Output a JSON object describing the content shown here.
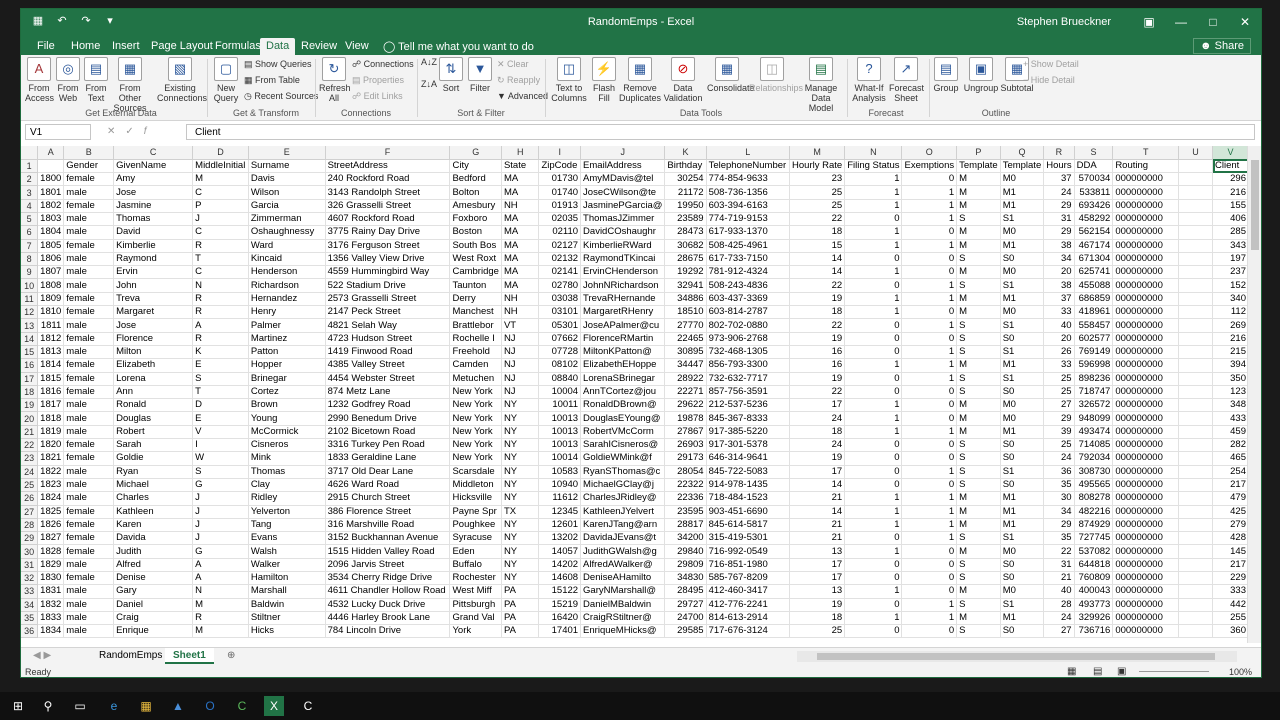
{
  "window": {
    "title": "RandomEmps - Excel",
    "user": "Stephen Brueckner"
  },
  "tabs": [
    "File",
    "Home",
    "Insert",
    "Page Layout",
    "Formulas",
    "Data",
    "Review",
    "View"
  ],
  "tell_me": "Tell me what you want to do",
  "share": "Share",
  "ribbon": {
    "from_access": "From Access",
    "from_web": "From Web",
    "from_text": "From Text",
    "from_other": "From Other Sources",
    "existing_connections": "Existing Connections",
    "new_query": "New Query",
    "show_queries": "Show Queries",
    "from_table": "From Table",
    "recent_sources": "Recent Sources",
    "refresh_all": "Refresh All",
    "connections": "Connections",
    "properties": "Properties",
    "edit_links": "Edit Links",
    "sort": "Sort",
    "filter": "Filter",
    "clear": "Clear",
    "reapply": "Reapply",
    "advanced": "Advanced",
    "text_to_columns": "Text to Columns",
    "flash_fill": "Flash Fill",
    "remove_duplicates": "Remove Duplicates",
    "data_validation": "Data Validation",
    "consolidate": "Consolidate",
    "relationships": "Relationships",
    "manage_data_model": "Manage Data Model",
    "what_if": "What-If Analysis",
    "forecast_sheet": "Forecast Sheet",
    "group": "Group",
    "ungroup": "Ungroup",
    "subtotal": "Subtotal",
    "show_detail": "Show Detail",
    "hide_detail": "Hide Detail",
    "groups": [
      "Get External Data",
      "Get & Transform",
      "Connections",
      "Sort & Filter",
      "Data Tools",
      "Forecast",
      "Outline"
    ]
  },
  "name_box": "V1",
  "formula": "Client",
  "columns": [
    "A",
    "B",
    "C",
    "D",
    "E",
    "F",
    "G",
    "H",
    "I",
    "J",
    "K",
    "L",
    "M",
    "N",
    "O",
    "P",
    "Q",
    "R",
    "S",
    "T",
    "U",
    "V"
  ],
  "header_row": [
    "",
    "Gender",
    "GivenName",
    "MiddleInitial",
    "Surname",
    "StreetAddress",
    "City",
    "State",
    "ZipCode",
    "EmailAddress",
    "Birthday",
    "TelephoneNumber",
    "Hourly Rate",
    "Filing Status",
    "Exemptions",
    "Template",
    "Template",
    "Hours",
    "DDA",
    "Routing",
    "",
    "Client"
  ],
  "rows": [
    [
      "1800",
      "female",
      "Amy",
      "M",
      "Davis",
      "240 Rockford Road",
      "Bedford",
      "MA",
      "01730",
      "AmyMDavis@tel",
      "30254",
      "774-854-9633",
      "23",
      "1",
      "0",
      "M",
      "M0",
      "37",
      "570034",
      "000000000",
      "",
      "296"
    ],
    [
      "1801",
      "male",
      "Jose",
      "C",
      "Wilson",
      "3143 Randolph Street",
      "Bolton",
      "MA",
      "01740",
      "JoseCWilson@te",
      "21172",
      "508-736-1356",
      "25",
      "1",
      "1",
      "M",
      "M1",
      "24",
      "533811",
      "000000000",
      "",
      "216"
    ],
    [
      "1802",
      "female",
      "Jasmine",
      "P",
      "Garcia",
      "326 Grasselli Street",
      "Amesbury",
      "NH",
      "01913",
      "JasminePGarcia@",
      "19950",
      "603-394-6163",
      "25",
      "1",
      "1",
      "M",
      "M1",
      "29",
      "693426",
      "000000000",
      "",
      "155"
    ],
    [
      "1803",
      "male",
      "Thomas",
      "J",
      "Zimmerman",
      "4607 Rockford Road",
      "Foxboro",
      "MA",
      "02035",
      "ThomasJZimmer",
      "23589",
      "774-719-9153",
      "22",
      "0",
      "1",
      "S",
      "S1",
      "31",
      "458292",
      "000000000",
      "",
      "406"
    ],
    [
      "1804",
      "male",
      "David",
      "C",
      "Oshaughnessy",
      "3775 Rainy Day Drive",
      "Boston",
      "MA",
      "02110",
      "DavidCOshaughr",
      "28473",
      "617-933-1370",
      "18",
      "1",
      "0",
      "M",
      "M0",
      "29",
      "562154",
      "000000000",
      "",
      "285"
    ],
    [
      "1805",
      "female",
      "Kimberlie",
      "R",
      "Ward",
      "3176 Ferguson Street",
      "South Bos",
      "MA",
      "02127",
      "KimberlieRWard",
      "30682",
      "508-425-4961",
      "15",
      "1",
      "1",
      "M",
      "M1",
      "38",
      "467174",
      "000000000",
      "",
      "343"
    ],
    [
      "1806",
      "male",
      "Raymond",
      "T",
      "Kincaid",
      "1356 Valley View Drive",
      "West Roxt",
      "MA",
      "02132",
      "RaymondTKincai",
      "28675",
      "617-733-7150",
      "14",
      "0",
      "0",
      "S",
      "S0",
      "34",
      "671304",
      "000000000",
      "",
      "197"
    ],
    [
      "1807",
      "male",
      "Ervin",
      "C",
      "Henderson",
      "4559 Hummingbird Way",
      "Cambridge",
      "MA",
      "02141",
      "ErvinCHenderson",
      "19292",
      "781-912-4324",
      "14",
      "1",
      "0",
      "M",
      "M0",
      "20",
      "625741",
      "000000000",
      "",
      "237"
    ],
    [
      "1808",
      "male",
      "John",
      "N",
      "Richardson",
      "522 Stadium Drive",
      "Taunton",
      "MA",
      "02780",
      "JohnNRichardson",
      "32941",
      "508-243-4836",
      "22",
      "0",
      "1",
      "S",
      "S1",
      "38",
      "455088",
      "000000000",
      "",
      "152"
    ],
    [
      "1809",
      "female",
      "Treva",
      "R",
      "Hernandez",
      "2573 Grasselli Street",
      "Derry",
      "NH",
      "03038",
      "TrevaRHernande",
      "34886",
      "603-437-3369",
      "19",
      "1",
      "1",
      "M",
      "M1",
      "37",
      "686859",
      "000000000",
      "",
      "340"
    ],
    [
      "1810",
      "female",
      "Margaret",
      "R",
      "Henry",
      "2147 Peck Street",
      "Manchest",
      "NH",
      "03101",
      "MargaretRHenry",
      "18510",
      "603-814-2787",
      "18",
      "1",
      "0",
      "M",
      "M0",
      "33",
      "418961",
      "000000000",
      "",
      "112"
    ],
    [
      "1811",
      "male",
      "Jose",
      "A",
      "Palmer",
      "4821 Selah Way",
      "Brattlebor",
      "VT",
      "05301",
      "JoseAPalmer@cu",
      "27770",
      "802-702-0880",
      "22",
      "0",
      "1",
      "S",
      "S1",
      "40",
      "558457",
      "000000000",
      "",
      "269"
    ],
    [
      "1812",
      "female",
      "Florence",
      "R",
      "Martinez",
      "4723 Hudson Street",
      "Rochelle I",
      "NJ",
      "07662",
      "FlorenceRMartin",
      "22465",
      "973-906-2768",
      "19",
      "0",
      "0",
      "S",
      "S0",
      "20",
      "602577",
      "000000000",
      "",
      "216"
    ],
    [
      "1813",
      "male",
      "Milton",
      "K",
      "Patton",
      "1419 Finwood Road",
      "Freehold",
      "NJ",
      "07728",
      "MiltonKPatton@",
      "30895",
      "732-468-1305",
      "16",
      "0",
      "1",
      "S",
      "S1",
      "26",
      "769149",
      "000000000",
      "",
      "215"
    ],
    [
      "1814",
      "female",
      "Elizabeth",
      "E",
      "Hopper",
      "4385 Valley Street",
      "Camden",
      "NJ",
      "08102",
      "ElizabethEHoppe",
      "34447",
      "856-793-3300",
      "16",
      "1",
      "1",
      "M",
      "M1",
      "33",
      "596998",
      "000000000",
      "",
      "394"
    ],
    [
      "1815",
      "female",
      "Lorena",
      "S",
      "Brinegar",
      "4454 Webster Street",
      "Metuchen",
      "NJ",
      "08840",
      "LorenaSBrinegar",
      "28922",
      "732-632-7717",
      "19",
      "0",
      "1",
      "S",
      "S1",
      "25",
      "898236",
      "000000000",
      "",
      "350"
    ],
    [
      "1816",
      "female",
      "Ann",
      "T",
      "Cortez",
      "874 Metz Lane",
      "New York",
      "NJ",
      "10004",
      "AnnTCortez@jou",
      "22271",
      "857-756-3591",
      "22",
      "0",
      "0",
      "S",
      "S0",
      "25",
      "718747",
      "000000000",
      "",
      "123"
    ],
    [
      "1817",
      "male",
      "Ronald",
      "D",
      "Brown",
      "1232 Godfrey Road",
      "New York",
      "NY",
      "10011",
      "RonaldDBrown@",
      "29622",
      "212-537-5236",
      "17",
      "1",
      "0",
      "M",
      "M0",
      "27",
      "326572",
      "000000000",
      "",
      "348"
    ],
    [
      "1818",
      "male",
      "Douglas",
      "E",
      "Young",
      "2990 Benedum Drive",
      "New York",
      "NY",
      "10013",
      "DouglasEYoung@",
      "19878",
      "845-367-8333",
      "24",
      "1",
      "0",
      "M",
      "M0",
      "29",
      "948099",
      "000000000",
      "",
      "433"
    ],
    [
      "1819",
      "male",
      "Robert",
      "V",
      "McCormick",
      "2102 Bicetown Road",
      "New York",
      "NY",
      "10013",
      "RobertVMcCorm",
      "27867",
      "917-385-5220",
      "18",
      "1",
      "1",
      "M",
      "M1",
      "39",
      "493474",
      "000000000",
      "",
      "459"
    ],
    [
      "1820",
      "female",
      "Sarah",
      "I",
      "Cisneros",
      "3316 Turkey Pen Road",
      "New York",
      "NY",
      "10013",
      "SarahICisneros@",
      "26903",
      "917-301-5378",
      "24",
      "0",
      "0",
      "S",
      "S0",
      "25",
      "714085",
      "000000000",
      "",
      "282"
    ],
    [
      "1821",
      "female",
      "Goldie",
      "W",
      "Mink",
      "1833 Geraldine Lane",
      "New York",
      "NY",
      "10014",
      "GoldieWMink@f",
      "29173",
      "646-314-9641",
      "19",
      "0",
      "0",
      "S",
      "S0",
      "24",
      "792034",
      "000000000",
      "",
      "465"
    ],
    [
      "1822",
      "male",
      "Ryan",
      "S",
      "Thomas",
      "3717 Old Dear Lane",
      "Scarsdale",
      "NY",
      "10583",
      "RyanSThomas@c",
      "28054",
      "845-722-5083",
      "17",
      "0",
      "1",
      "S",
      "S1",
      "36",
      "308730",
      "000000000",
      "",
      "254"
    ],
    [
      "1823",
      "male",
      "Michael",
      "G",
      "Clay",
      "4626 Ward Road",
      "Middleton",
      "NY",
      "10940",
      "MichaelGClay@j",
      "22322",
      "914-978-1435",
      "14",
      "0",
      "0",
      "S",
      "S0",
      "35",
      "495565",
      "000000000",
      "",
      "217"
    ],
    [
      "1824",
      "male",
      "Charles",
      "J",
      "Ridley",
      "2915 Church Street",
      "Hicksville",
      "NY",
      "11612",
      "CharlesJRidley@",
      "22336",
      "718-484-1523",
      "21",
      "1",
      "1",
      "M",
      "M1",
      "30",
      "808278",
      "000000000",
      "",
      "479"
    ],
    [
      "1825",
      "female",
      "Kathleen",
      "J",
      "Yelverton",
      "386 Florence Street",
      "Payne Spr",
      "TX",
      "12345",
      "KathleenJYelvert",
      "23595",
      "903-451-6690",
      "14",
      "1",
      "1",
      "M",
      "M1",
      "34",
      "482216",
      "000000000",
      "",
      "425"
    ],
    [
      "1826",
      "female",
      "Karen",
      "J",
      "Tang",
      "316 Marshville Road",
      "Poughkee",
      "NY",
      "12601",
      "KarenJTang@arn",
      "28817",
      "845-614-5817",
      "21",
      "1",
      "1",
      "M",
      "M1",
      "29",
      "874929",
      "000000000",
      "",
      "279"
    ],
    [
      "1827",
      "female",
      "Davida",
      "J",
      "Evans",
      "3152 Buckhannan Avenue",
      "Syracuse",
      "NY",
      "13202",
      "DavidaJEvans@t",
      "34200",
      "315-419-5301",
      "21",
      "0",
      "1",
      "S",
      "S1",
      "35",
      "727745",
      "000000000",
      "",
      "428"
    ],
    [
      "1828",
      "female",
      "Judith",
      "G",
      "Walsh",
      "1515 Hidden Valley Road",
      "Eden",
      "NY",
      "14057",
      "JudithGWalsh@g",
      "29840",
      "716-992-0549",
      "13",
      "1",
      "0",
      "M",
      "M0",
      "22",
      "537082",
      "000000000",
      "",
      "145"
    ],
    [
      "1829",
      "male",
      "Alfred",
      "A",
      "Walker",
      "2096 Jarvis Street",
      "Buffalo",
      "NY",
      "14202",
      "AlfredAWalker@",
      "29809",
      "716-851-1980",
      "17",
      "0",
      "0",
      "S",
      "S0",
      "31",
      "644818",
      "000000000",
      "",
      "217"
    ],
    [
      "1830",
      "female",
      "Denise",
      "A",
      "Hamilton",
      "3534 Cherry Ridge Drive",
      "Rochester",
      "NY",
      "14608",
      "DeniseAHamilto",
      "34830",
      "585-767-8209",
      "17",
      "0",
      "0",
      "S",
      "S0",
      "21",
      "760809",
      "000000000",
      "",
      "229"
    ],
    [
      "1831",
      "male",
      "Gary",
      "N",
      "Marshall",
      "4611 Chandler Hollow Road",
      "West Miff",
      "PA",
      "15122",
      "GaryNMarshall@",
      "28495",
      "412-460-3417",
      "13",
      "1",
      "0",
      "M",
      "M0",
      "40",
      "400043",
      "000000000",
      "",
      "333"
    ],
    [
      "1832",
      "male",
      "Daniel",
      "M",
      "Baldwin",
      "4532 Lucky Duck Drive",
      "Pittsburgh",
      "PA",
      "15219",
      "DanielMBaldwin",
      "29727",
      "412-776-2241",
      "19",
      "0",
      "1",
      "S",
      "S1",
      "28",
      "493773",
      "000000000",
      "",
      "442"
    ],
    [
      "1833",
      "male",
      "Craig",
      "R",
      "Stiltner",
      "4446 Harley Brook Lane",
      "Grand Val",
      "PA",
      "16420",
      "CraigRStiltner@",
      "24700",
      "814-613-2914",
      "18",
      "1",
      "1",
      "M",
      "M1",
      "24",
      "329926",
      "000000000",
      "",
      "255"
    ],
    [
      "1834",
      "male",
      "Enrique",
      "M",
      "Hicks",
      "784 Lincoln Drive",
      "York",
      "PA",
      "17401",
      "EnriqueMHicks@",
      "29585",
      "717-676-3124",
      "25",
      "0",
      "0",
      "S",
      "S0",
      "27",
      "736716",
      "000000000",
      "",
      "360"
    ]
  ],
  "sheets": [
    "RandomEmps",
    "Sheet1"
  ],
  "status": {
    "ready": "Ready",
    "zoom": "100%"
  }
}
